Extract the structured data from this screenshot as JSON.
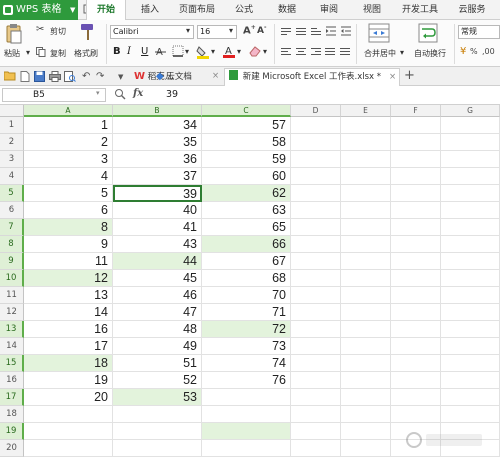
{
  "app": {
    "name": "WPS 表格",
    "menu_tabs": [
      "开始",
      "插入",
      "页面布局",
      "公式",
      "数据",
      "审阅",
      "视图",
      "开发工具",
      "云服务"
    ],
    "active_tab": "开始"
  },
  "ribbon": {
    "paste": "粘贴",
    "cut": "剪切",
    "copy": "复制",
    "format_painter": "格式刷",
    "font_name": "Calibri",
    "font_size": "16",
    "merge_center": "合并居中",
    "wrap_text": "自动换行",
    "number_format": "常规"
  },
  "doc_tabs": [
    {
      "label": "稻壳儿",
      "active": false
    },
    {
      "label": "云文档",
      "active": false
    },
    {
      "label": "新建 Microsoft Excel 工作表.xlsx *",
      "active": true
    }
  ],
  "formula_bar": {
    "name_box": "B5",
    "fx_label": "fx",
    "value": "39"
  },
  "columns": [
    "A",
    "B",
    "C",
    "D",
    "E",
    "F",
    "G"
  ],
  "rows": [
    {
      "num": "1",
      "A": "1",
      "B": "34",
      "C": "57"
    },
    {
      "num": "2",
      "A": "2",
      "B": "35",
      "C": "58"
    },
    {
      "num": "3",
      "A": "3",
      "B": "36",
      "C": "59"
    },
    {
      "num": "4",
      "A": "4",
      "B": "37",
      "C": "60"
    },
    {
      "num": "5",
      "A": "5",
      "B": "39",
      "C": "62"
    },
    {
      "num": "6",
      "A": "6",
      "B": "40",
      "C": "63"
    },
    {
      "num": "7",
      "A": "8",
      "B": "41",
      "C": "65"
    },
    {
      "num": "8",
      "A": "9",
      "B": "43",
      "C": "66"
    },
    {
      "num": "9",
      "A": "11",
      "B": "44",
      "C": "67"
    },
    {
      "num": "10",
      "A": "12",
      "B": "45",
      "C": "68"
    },
    {
      "num": "11",
      "A": "13",
      "B": "46",
      "C": "70"
    },
    {
      "num": "12",
      "A": "14",
      "B": "47",
      "C": "71"
    },
    {
      "num": "13",
      "A": "16",
      "B": "48",
      "C": "72"
    },
    {
      "num": "14",
      "A": "17",
      "B": "49",
      "C": "73"
    },
    {
      "num": "15",
      "A": "18",
      "B": "51",
      "C": "74"
    },
    {
      "num": "16",
      "A": "19",
      "B": "52",
      "C": "76"
    },
    {
      "num": "17",
      "A": "20",
      "B": "53",
      "C": ""
    },
    {
      "num": "18",
      "A": "",
      "B": "",
      "C": ""
    },
    {
      "num": "19",
      "A": "",
      "B": "",
      "C": ""
    },
    {
      "num": "20",
      "A": "",
      "B": "",
      "C": ""
    }
  ],
  "highlighted_cells": [
    "C5",
    "A7",
    "C8",
    "B9",
    "A10",
    "C13",
    "A15",
    "B17",
    "C19"
  ],
  "selected_rows": [
    "5",
    "7",
    "8",
    "9",
    "10",
    "13",
    "15",
    "17",
    "19"
  ],
  "selected_columns": [
    "A",
    "B",
    "C"
  ],
  "active_cell": "B5",
  "highlight_color": "#e3f3dc",
  "accent_color": "#2e9a3c",
  "watermark": "Baidu经验"
}
